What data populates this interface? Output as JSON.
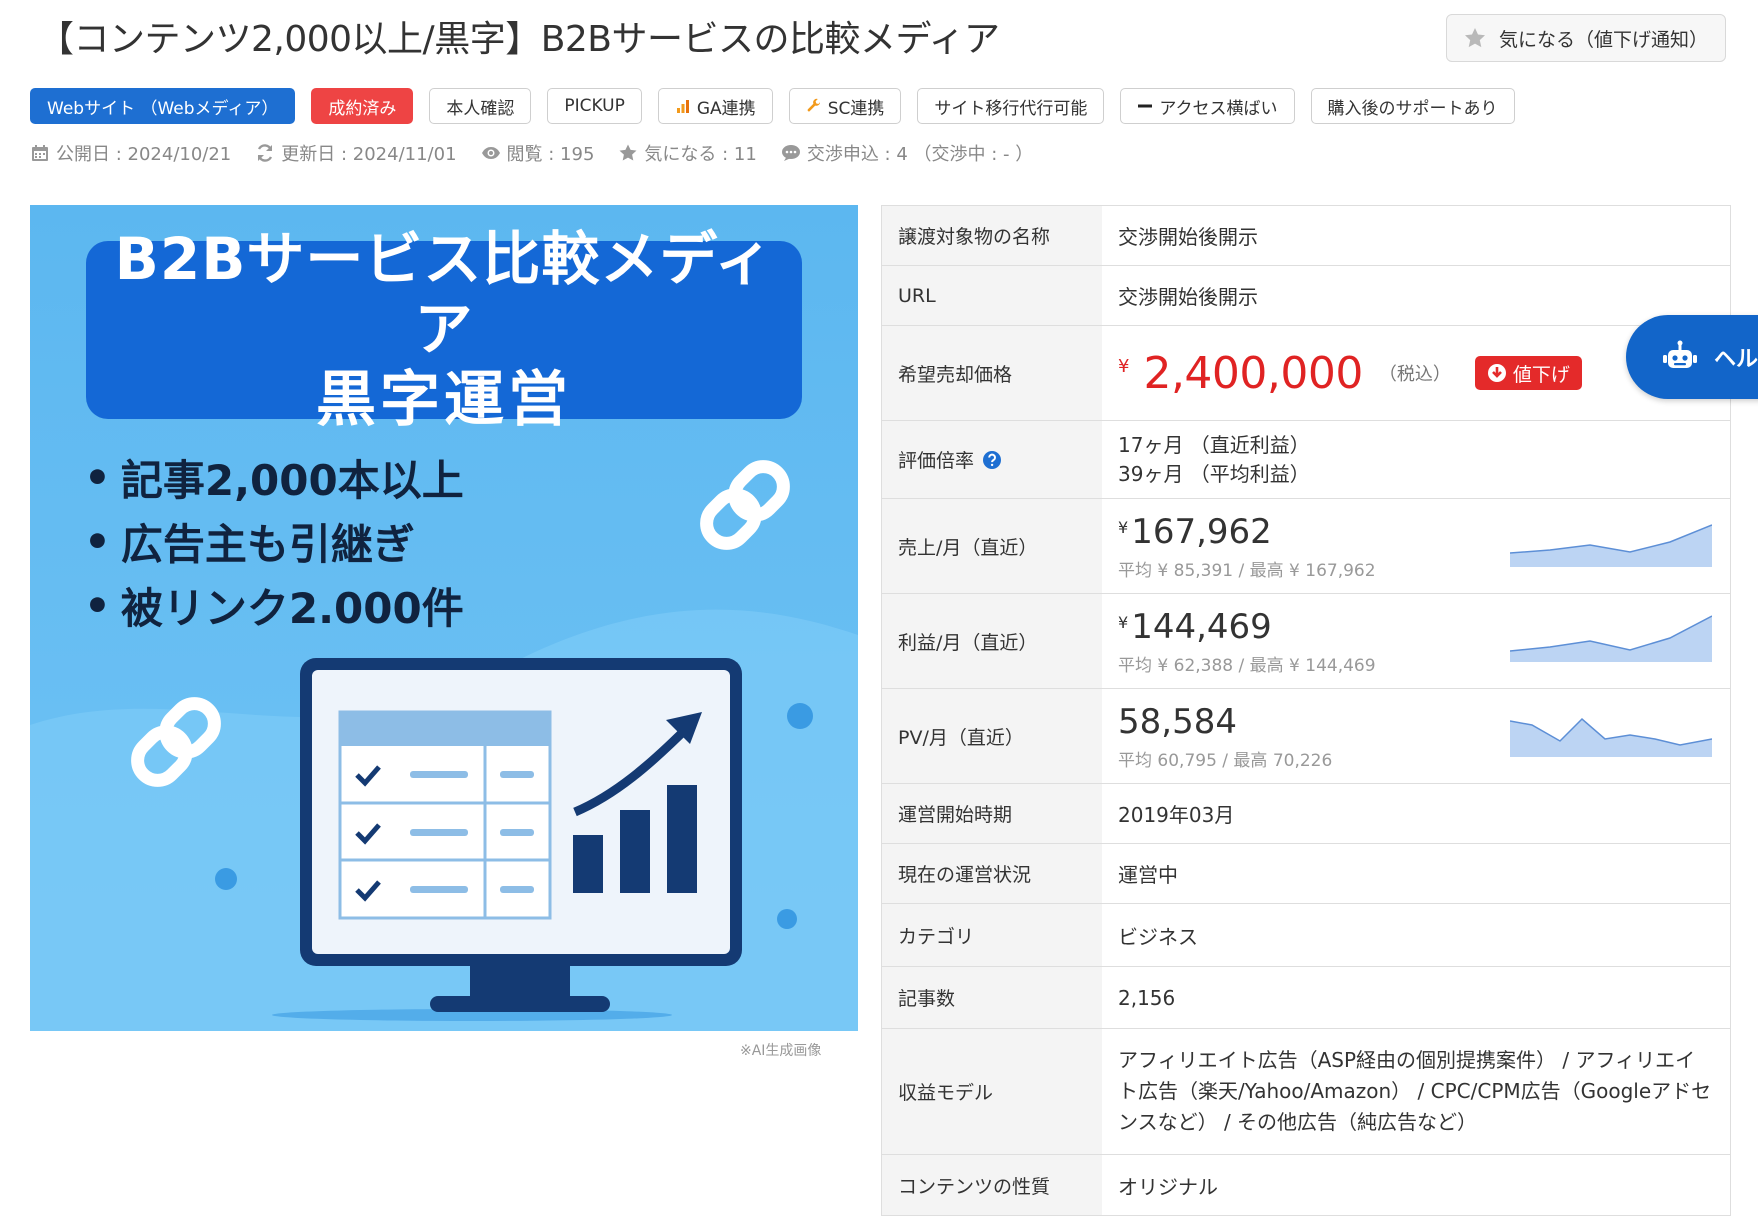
{
  "title": "【コンテンツ2,000以上/黒字】B2Bサービスの比較メディア",
  "fav_button": "気になる（値下げ通知）",
  "tags": [
    {
      "label": "Webサイト （Webメディア）",
      "kind": "primary",
      "icon": ""
    },
    {
      "label": "成約済み",
      "kind": "done",
      "icon": ""
    },
    {
      "label": "本人確認",
      "kind": "plain",
      "icon": ""
    },
    {
      "label": "PICKUP",
      "kind": "plain",
      "icon": ""
    },
    {
      "label": "GA連携",
      "kind": "plain",
      "icon": "bar-chart-icon"
    },
    {
      "label": "SC連携",
      "kind": "plain",
      "icon": "wrench-icon"
    },
    {
      "label": "サイト移行代行可能",
      "kind": "plain",
      "icon": ""
    },
    {
      "label": "アクセス横ばい",
      "kind": "plain",
      "icon": "minus-icon"
    },
    {
      "label": "購入後のサポートあり",
      "kind": "plain",
      "icon": ""
    }
  ],
  "meta": {
    "published": "公開日 : 2024/10/21",
    "updated": "更新日 : 2024/11/01",
    "views": "閲覧 : 195",
    "favorites": "気になる : 11",
    "offers": "交渉申込 : 4 （交渉中 : - ）"
  },
  "hero": {
    "banner_line1": "B2Bサービス比較メディア",
    "banner_line2": "黒字運営",
    "bullets": [
      "記事2,000本以上",
      "広告主も引継ぎ",
      "被リンク2.000件"
    ],
    "caption": "※AI生成画像"
  },
  "table": {
    "name_label": "譲渡対象物の名称",
    "name_value": "交渉開始後開示",
    "url_label": "URL",
    "url_value": "交渉開始後開示",
    "price_label": "希望売却価格",
    "price_yen": "¥",
    "price_value": "2,400,000",
    "price_tax": "（税込）",
    "price_badge": "値下げ",
    "ratio_label": "評価倍率",
    "ratio_line1": "17ヶ月 （直近利益）",
    "ratio_line2": "39ヶ月 （平均利益）",
    "sales_label": "売上/月（直近）",
    "sales_value": "167,962",
    "sales_sub": "平均 ¥ 85,391 / 最高 ¥ 167,962",
    "profit_label": "利益/月（直近）",
    "profit_value": "144,469",
    "profit_sub": "平均 ¥ 62,388 / 最高 ¥ 144,469",
    "pv_label": "PV/月（直近）",
    "pv_value": "58,584",
    "pv_sub": "平均 60,795 / 最高 70,226",
    "start_label": "運営開始時期",
    "start_value": "2019年03月",
    "status_label": "現在の運営状況",
    "status_value": "運営中",
    "category_label": "カテゴリ",
    "category_value": "ビジネス",
    "articles_label": "記事数",
    "articles_value": "2,156",
    "revenue_label": "収益モデル",
    "revenue_value": "アフィリエイト広告（ASP経由の個別提携案件） / アフィリエイト広告（楽天/Yahoo/Amazon） / CPC/CPM広告（Googleアドセンスなど） / その他広告（純広告など）",
    "content_label": "コンテンツの性質",
    "content_value": "オリジナル",
    "yen": "¥"
  },
  "help_tab": "ヘルプ",
  "colors": {
    "primary": "#1e6fd2",
    "danger": "#e42a2a",
    "hero_bg": "#5cb7f0"
  }
}
